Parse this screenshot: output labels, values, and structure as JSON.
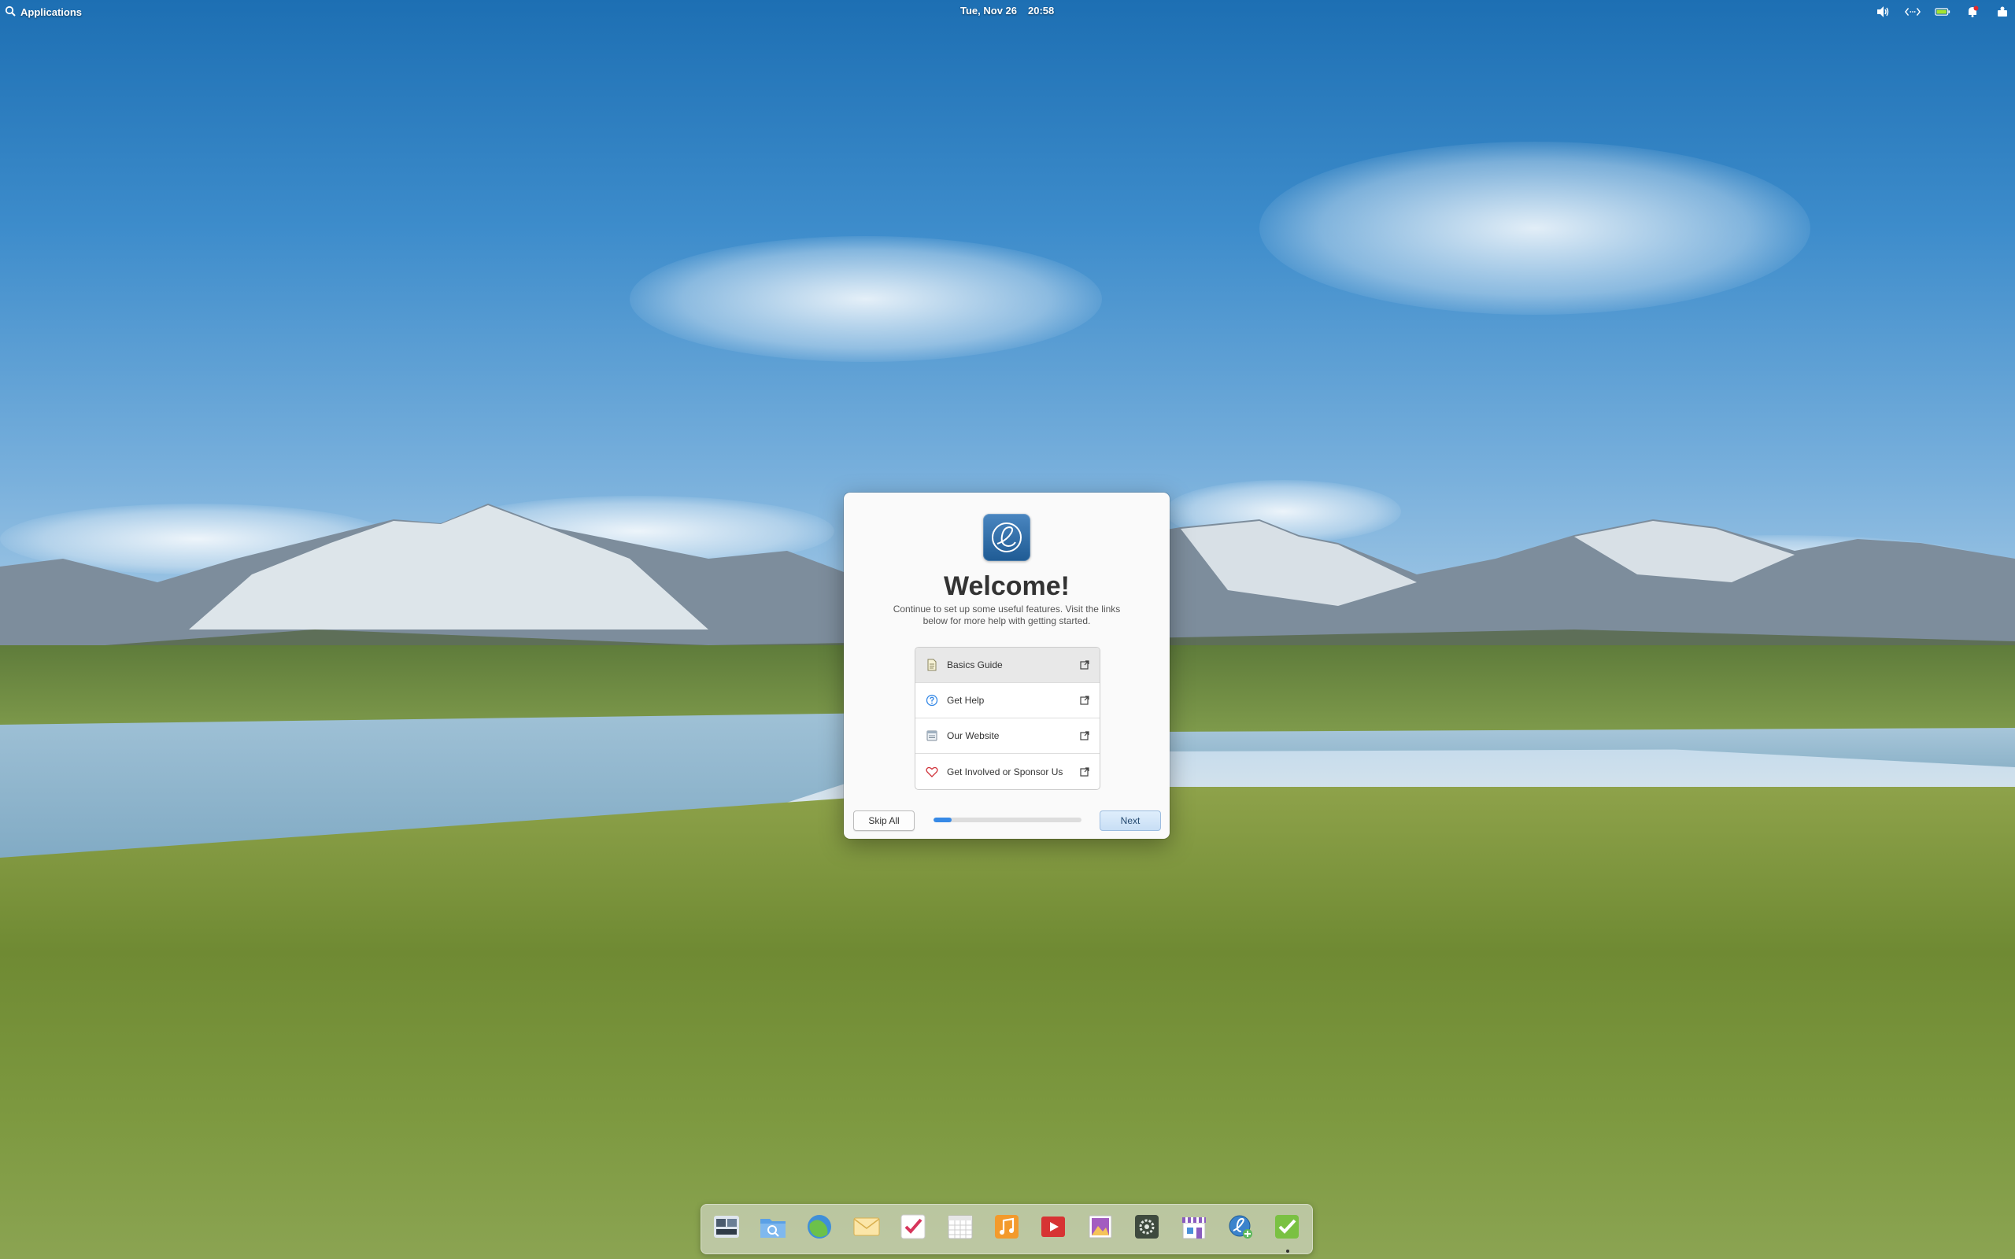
{
  "panel": {
    "applications_label": "Applications",
    "date": "Tue, Nov 26",
    "time": "20:58",
    "indicators": [
      "volume-icon",
      "network-icon",
      "battery-icon",
      "notifications-icon",
      "session-icon"
    ]
  },
  "dialog": {
    "title": "Welcome!",
    "subtitle": "Continue to set up some useful features. Visit the links below for more help with getting started.",
    "links": [
      {
        "label": "Basics Guide",
        "icon": "document-icon"
      },
      {
        "label": "Get Help",
        "icon": "help-icon"
      },
      {
        "label": "Our Website",
        "icon": "website-icon"
      },
      {
        "label": "Get Involved or Sponsor Us",
        "icon": "heart-icon"
      }
    ],
    "skip_label": "Skip All",
    "next_label": "Next",
    "progress": 0.12
  },
  "dock": {
    "items": [
      {
        "name": "multitasking-view",
        "icon": "multitasking-icon",
        "color": "#4b5b6e",
        "running": false
      },
      {
        "name": "files",
        "icon": "files-icon",
        "color": "#4a90d9",
        "running": false
      },
      {
        "name": "web-browser",
        "icon": "browser-icon",
        "color": "#5aa33a",
        "running": false
      },
      {
        "name": "mail",
        "icon": "mail-icon",
        "color": "#f2c25a",
        "running": false
      },
      {
        "name": "tasks",
        "icon": "tasks-icon",
        "color": "#f4f4f4",
        "running": false
      },
      {
        "name": "calendar",
        "icon": "calendar-icon",
        "color": "#eeeeee",
        "running": false
      },
      {
        "name": "music",
        "icon": "music-icon",
        "color": "#f39a2c",
        "running": false
      },
      {
        "name": "videos",
        "icon": "videos-icon",
        "color": "#d73333",
        "running": false
      },
      {
        "name": "photos",
        "icon": "photos-icon",
        "color": "#b35fa8",
        "running": false
      },
      {
        "name": "system-settings",
        "icon": "settings-icon",
        "color": "#3e4a3e",
        "running": false
      },
      {
        "name": "appcenter",
        "icon": "appcenter-icon",
        "color": "#8a5cbf",
        "running": false
      },
      {
        "name": "installer",
        "icon": "installer-icon",
        "color": "#2f6fb5",
        "running": false
      },
      {
        "name": "initial-setup",
        "icon": "checkmark-icon",
        "color": "#7ac142",
        "running": true
      }
    ]
  }
}
